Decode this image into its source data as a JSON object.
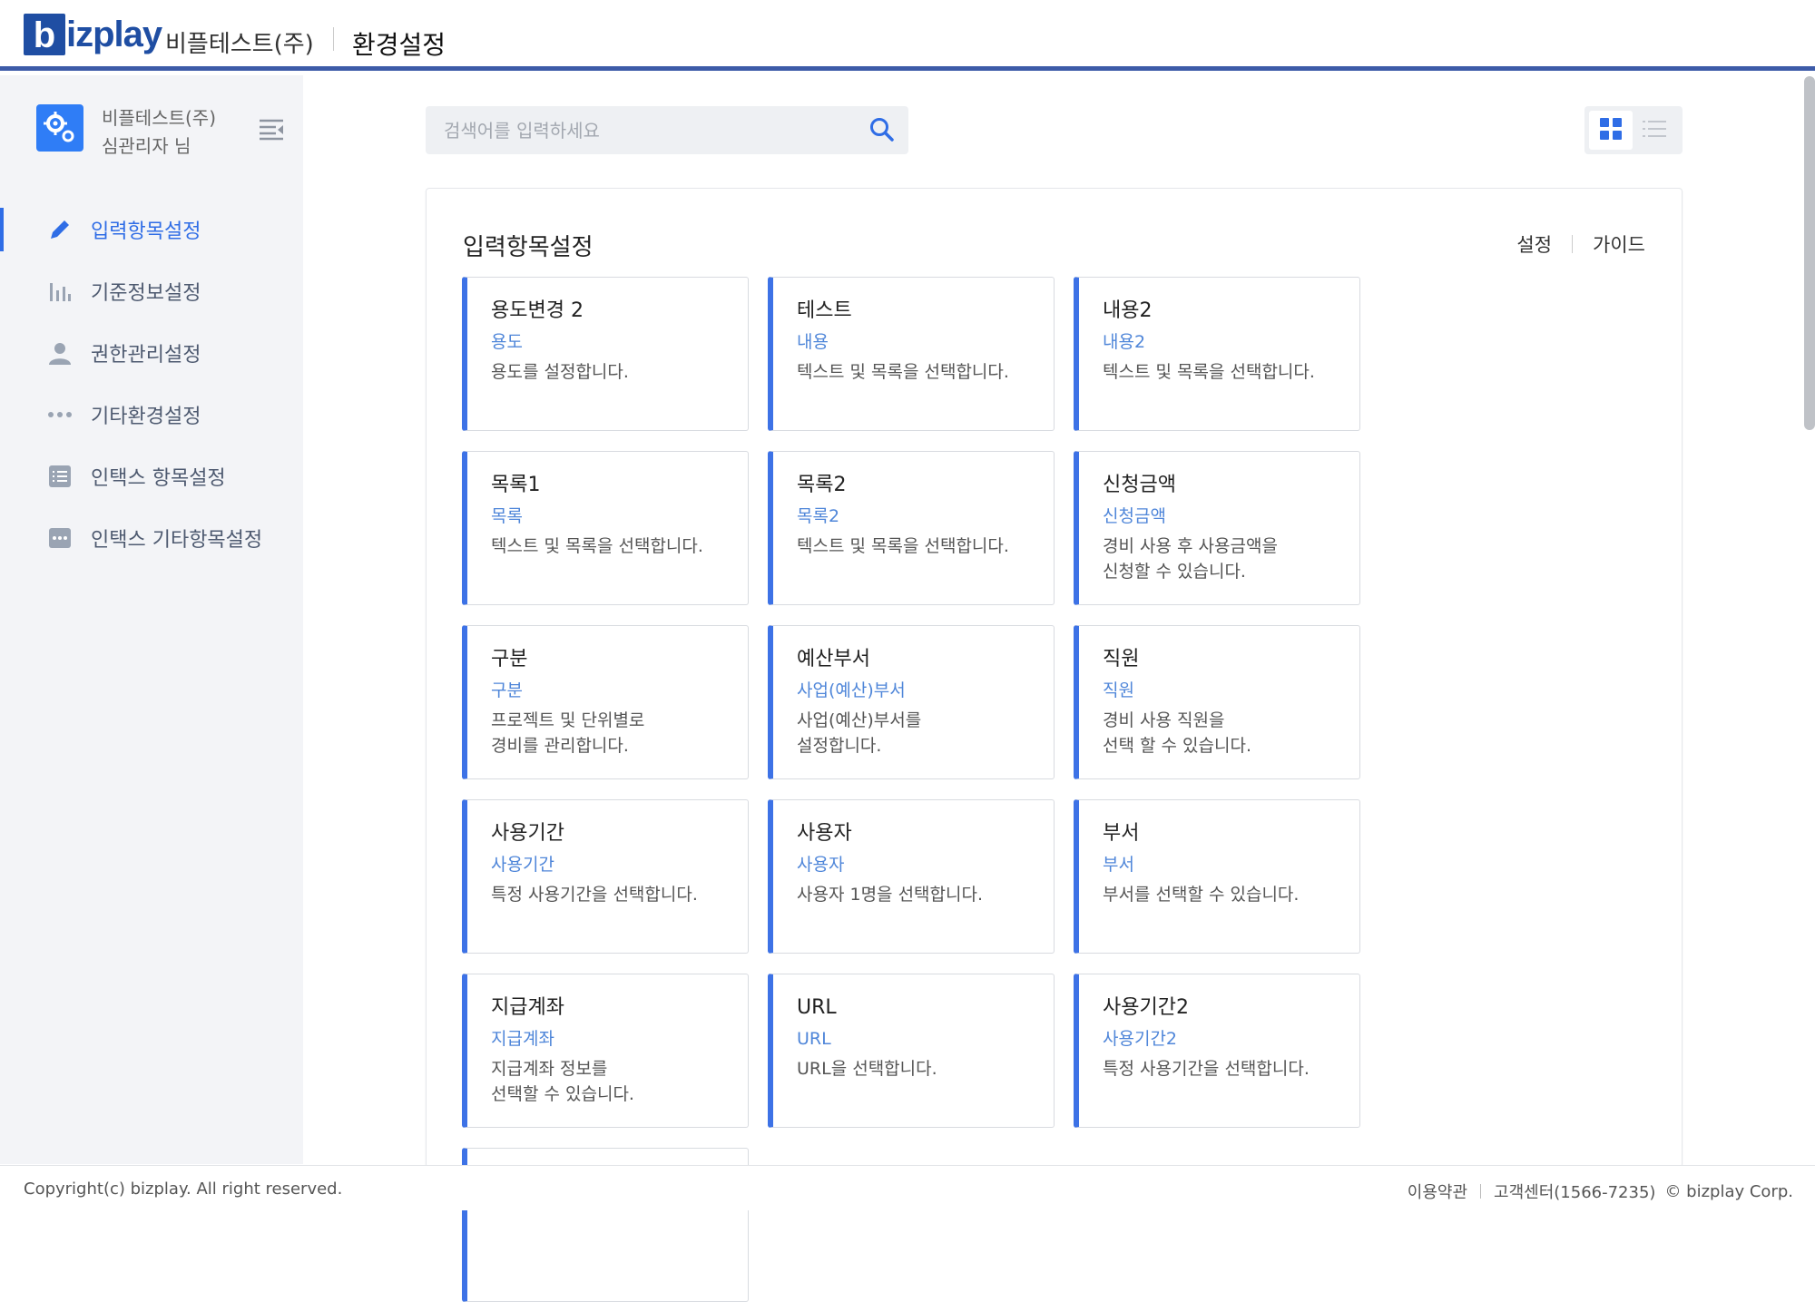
{
  "header": {
    "logo_b": "b",
    "logo_rest": "izplay",
    "company": "비플테스트(주)",
    "title": "환경설정"
  },
  "sidebar": {
    "user_company": "비플테스트(주)",
    "user_name": "심관리자 님",
    "items": [
      {
        "label": "입력항목설정",
        "icon": "pencil-icon",
        "active": true
      },
      {
        "label": "기준정보설정",
        "icon": "bar-chart-icon",
        "active": false
      },
      {
        "label": "권한관리설정",
        "icon": "user-icon",
        "active": false
      },
      {
        "label": "기타환경설정",
        "icon": "more-dots-icon",
        "active": false
      },
      {
        "label": "인택스 항목설정",
        "icon": "list-box-icon",
        "active": false
      },
      {
        "label": "인택스 기타항목설정",
        "icon": "dots-box-icon",
        "active": false
      }
    ]
  },
  "search": {
    "placeholder": "검색어를 입력하세요",
    "value": ""
  },
  "panel": {
    "title": "입력항목설정",
    "link_settings": "설정",
    "link_guide": "가이드",
    "cards": [
      {
        "title": "용도변경 2",
        "sub": "용도",
        "desc": "용도를 설정합니다."
      },
      {
        "title": "테스트",
        "sub": "내용",
        "desc": "텍스트 및 목록을 선택합니다."
      },
      {
        "title": "내용2",
        "sub": "내용2",
        "desc": "텍스트 및 목록을 선택합니다."
      },
      {
        "title": "목록1",
        "sub": "목록",
        "desc": "텍스트 및 목록을 선택합니다."
      },
      {
        "title": "목록2",
        "sub": "목록2",
        "desc": "텍스트 및 목록을 선택합니다."
      },
      {
        "title": "신청금액",
        "sub": "신청금액",
        "desc": "경비 사용 후 사용금액을\n신청할 수 있습니다."
      },
      {
        "title": "구분",
        "sub": "구분",
        "desc": "프로젝트 및 단위별로\n경비를 관리합니다."
      },
      {
        "title": "예산부서",
        "sub": "사업(예산)부서",
        "desc": "사업(예산)부서를\n설정합니다."
      },
      {
        "title": "직원",
        "sub": "직원",
        "desc": "경비 사용 직원을\n선택 할 수 있습니다."
      },
      {
        "title": "사용기간",
        "sub": "사용기간",
        "desc": "특정 사용기간을 선택합니다."
      },
      {
        "title": "사용자",
        "sub": "사용자",
        "desc": "사용자 1명을 선택합니다."
      },
      {
        "title": "부서",
        "sub": "부서",
        "desc": "부서를 선택할 수 있습니다."
      },
      {
        "title": "지급계좌",
        "sub": "지급계좌",
        "desc": "지급계좌 정보를\n선택할 수 있습니다."
      },
      {
        "title": "URL",
        "sub": "URL",
        "desc": "URL을 선택합니다."
      },
      {
        "title": "사용기간2",
        "sub": "사용기간2",
        "desc": "특정 사용기간을 선택합니다."
      }
    ]
  },
  "footer": {
    "copyright": "Copyright(c) bizplay. All right reserved.",
    "terms": "이용약관",
    "support": "고객센터(1566-7235)",
    "corp": "© bizplay Corp."
  },
  "colors": {
    "accent": "#2f6de6",
    "card_border_left": "#3d72e6",
    "header_rule": "#3d5ba8",
    "sidebar_bg": "#f3f4f7"
  }
}
